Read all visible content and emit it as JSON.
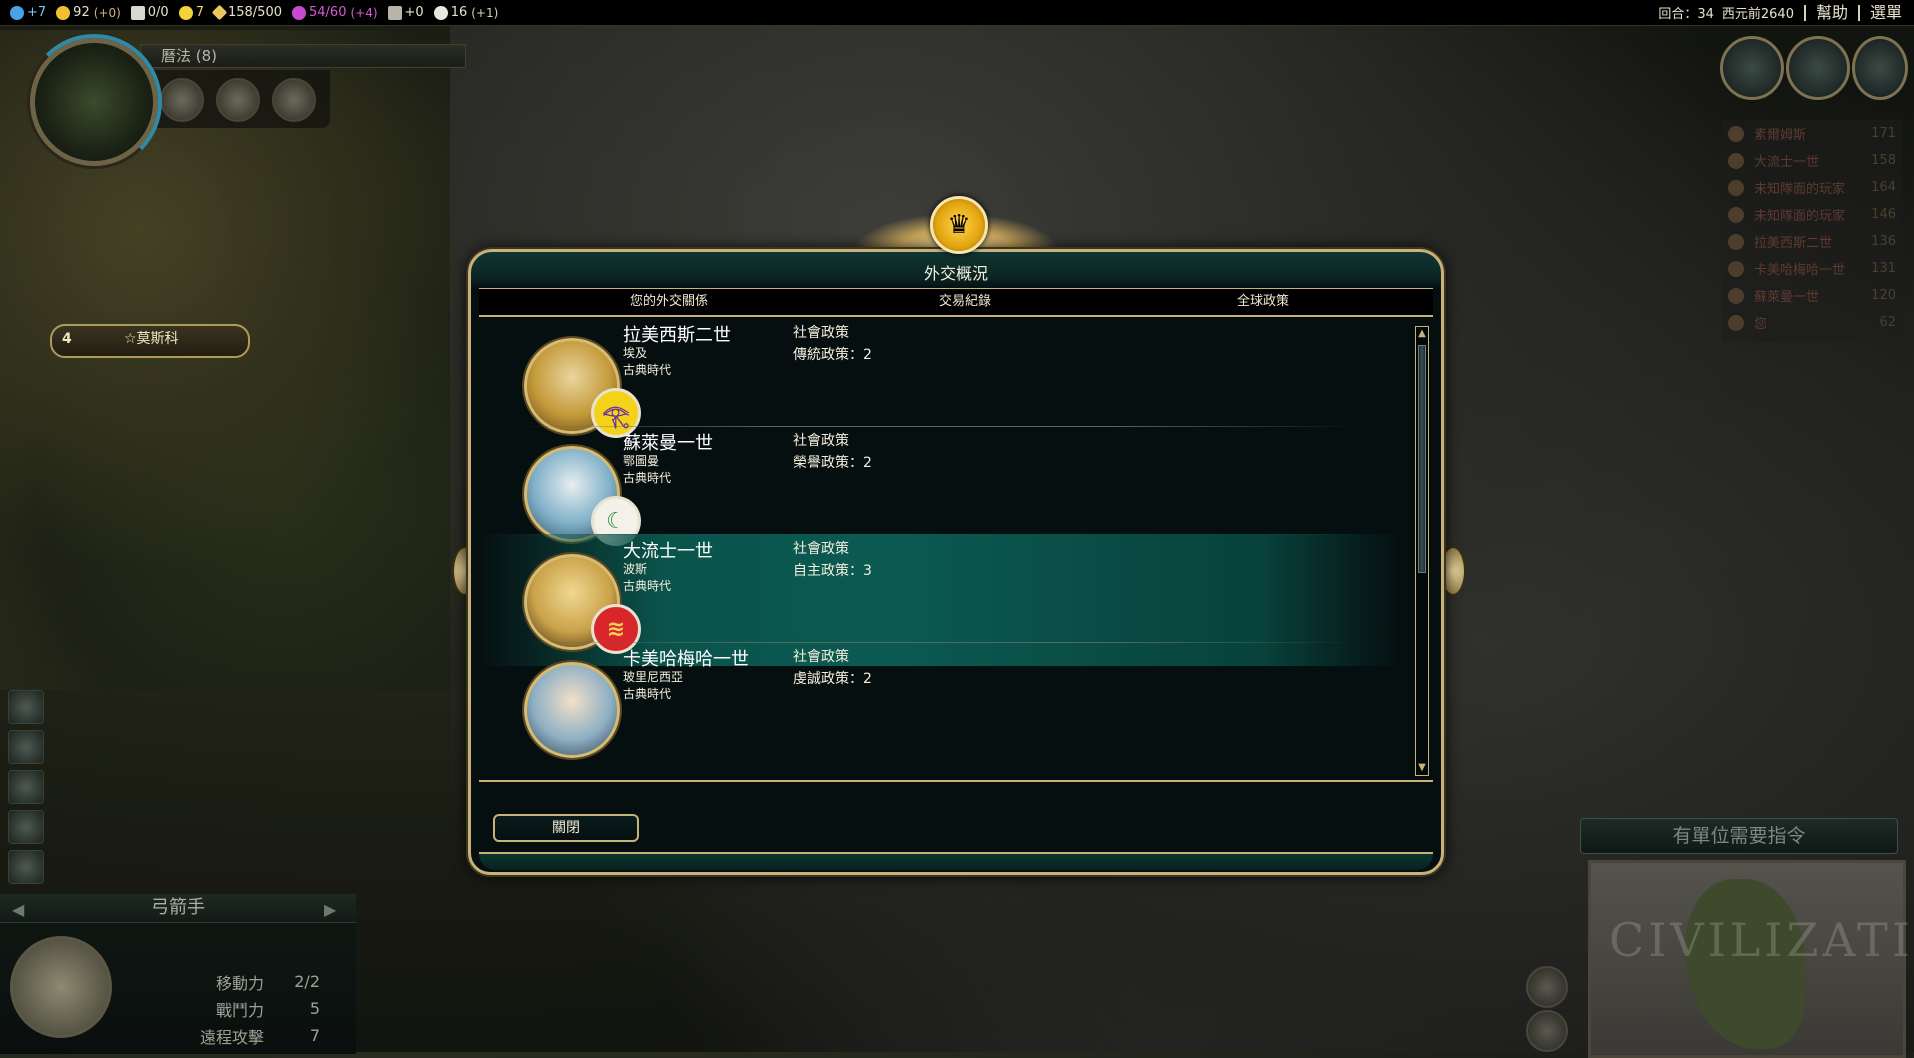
{
  "topbar": {
    "science": "+7",
    "gold": "92",
    "gold_rate": "(+0)",
    "trade_routes": "0/0",
    "happiness": "7",
    "golden_age": "158/500",
    "culture": "54/60",
    "culture_rate": "(+4)",
    "tourism": "+0",
    "faith": "16",
    "faith_rate": "(+1)",
    "turn": "回合：34",
    "year": "西元前2640",
    "help_button": "幫助",
    "menu_button": "選單"
  },
  "research": {
    "label": "曆法 (8)"
  },
  "city_banner": {
    "population": "4",
    "name": "☆莫斯科"
  },
  "unit_panel": {
    "unit_name": "弓箭手",
    "stats": [
      {
        "label": "移動力",
        "value": "2/2"
      },
      {
        "label": "戰鬥力",
        "value": "5"
      },
      {
        "label": "遠程攻擊",
        "value": "7"
      }
    ]
  },
  "scoreboard": [
    {
      "name": "素爾姆斯",
      "score": "171"
    },
    {
      "name": "大流士一世",
      "score": "158"
    },
    {
      "name": "未知隊面的玩家",
      "score": "164"
    },
    {
      "name": "未知隊面的玩家",
      "score": "146"
    },
    {
      "name": "拉美西斯二世",
      "score": "136"
    },
    {
      "name": "卡美哈梅哈一世",
      "score": "131"
    },
    {
      "name": "蘇萊曼一世",
      "score": "120"
    },
    {
      "name": "您",
      "score": "62"
    }
  ],
  "minimap": {
    "needs_orders": "有單位需要指令",
    "brand": "CIVILIZATION"
  },
  "dialog": {
    "title": "外交概況",
    "tabs": [
      "您的外交關係",
      "交易紀錄",
      "全球政策"
    ],
    "close_label": "關閉",
    "leaders": [
      {
        "name": "拉美西斯二世",
        "civ": "埃及",
        "era": "古典時代",
        "policy_header": "社會政策",
        "policy": "傳統政策：2",
        "badge_glyph": "𓂀",
        "badge_color": "#f4d21a",
        "badge_fg": "#6a2fa0",
        "portrait_color": "#c49a3a"
      },
      {
        "name": "蘇萊曼一世",
        "civ": "鄂圖曼",
        "era": "古典時代",
        "policy_header": "社會政策",
        "policy": "榮譽政策：2",
        "badge_glyph": "☾",
        "badge_color": "#f2f2ea",
        "badge_fg": "#2e8a3a",
        "portrait_color": "#7fb0c8"
      },
      {
        "name": "大流士一世",
        "civ": "波斯",
        "era": "古典時代",
        "policy_header": "社會政策",
        "policy": "自主政策：3",
        "badge_glyph": "≋",
        "badge_color": "#d8262a",
        "badge_fg": "#f3d05a",
        "portrait_color": "#caa24a"
      },
      {
        "name": "卡美哈梅哈一世",
        "civ": "玻里尼西亞",
        "era": "古典時代",
        "policy_header": "社會政策",
        "policy": "虔誠政策：2",
        "badge_glyph": "",
        "badge_color": "#2a6aa8",
        "badge_fg": "#ffffff",
        "portrait_color": "#8fb0c4"
      }
    ]
  }
}
